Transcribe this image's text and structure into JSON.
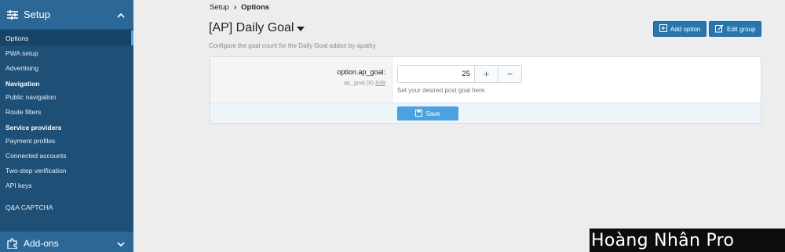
{
  "sidebar": {
    "header_title": "Setup",
    "header_icon": "sliders-icon",
    "items": [
      {
        "label": "Options",
        "active": true
      },
      {
        "label": "PWA setup"
      },
      {
        "label": "Advertising"
      }
    ],
    "sections": [
      {
        "title": "Navigation",
        "items": [
          {
            "label": "Public navigation"
          },
          {
            "label": "Route filters"
          }
        ]
      },
      {
        "title": "Service providers",
        "items": [
          {
            "label": "Payment profiles"
          },
          {
            "label": "Connected accounts"
          },
          {
            "label": "Two-step verification"
          },
          {
            "label": "API keys"
          }
        ]
      }
    ],
    "extra_item": "Q&A CAPTCHA",
    "footer_title": "Add-ons",
    "footer_icon": "puzzle-icon"
  },
  "breadcrumb": {
    "parent": "Setup",
    "separator": "›",
    "current": "Options"
  },
  "page": {
    "title": "[AP] Daily Goal",
    "description": "Configure the goal count for the Daily Goal addon by apathy"
  },
  "actions": {
    "add_option": "Add option",
    "edit_group": "Edit group"
  },
  "option": {
    "label": "option.ap_goal:",
    "sub": "ap_goal (8)",
    "edit": "Edit",
    "value": "25",
    "plus": "+",
    "minus": "−",
    "hint": "Set your desired post goal here."
  },
  "save_label": "Save",
  "watermark": "Hoàng Nhân Pro",
  "colors": {
    "sidebar": "#1d4f77",
    "accent": "#2577b1",
    "save": "#4aa3e0"
  }
}
